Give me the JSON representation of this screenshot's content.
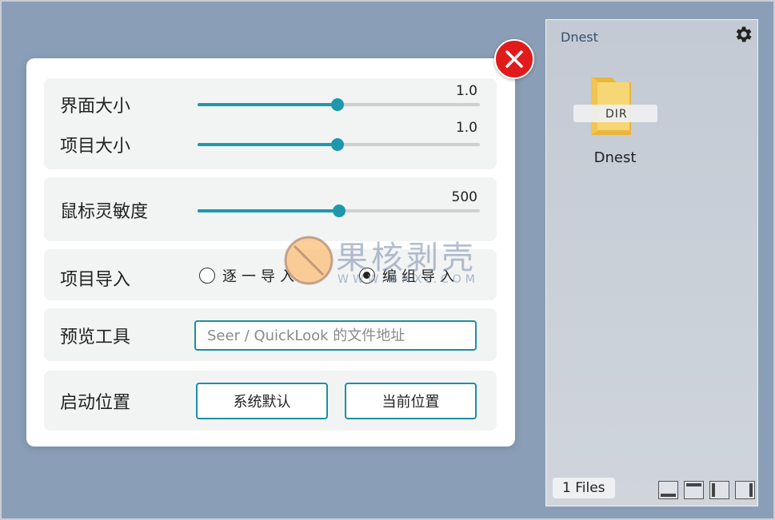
{
  "settings": {
    "ui_size": {
      "label": "界面大小",
      "value": "1.0",
      "fraction": 0.495
    },
    "item_size": {
      "label": "项目大小",
      "value": "1.0",
      "fraction": 0.495
    },
    "mouse_sensitivity": {
      "label": "鼠标灵敏度",
      "value": "500",
      "fraction": 0.5
    },
    "item_import": {
      "label": "项目导入",
      "options": [
        "逐一导入",
        "编组导入"
      ],
      "selected": "编组导入"
    },
    "preview_tool": {
      "label": "预览工具",
      "placeholder": "Seer / QuickLook 的文件地址"
    },
    "start_position": {
      "label": "启动位置",
      "buttons": [
        "系统默认",
        "当前位置"
      ]
    },
    "close_icon": "close-x-icon"
  },
  "watermark": {
    "title": "果核剥壳",
    "subtitle": "WWW.GHXI.COM"
  },
  "panel": {
    "title": "Dnest",
    "gear_icon": "gear-icon",
    "folder": {
      "badge": "DIR",
      "name": "Dnest"
    },
    "files_count": "1 Files",
    "layout_buttons": [
      "dock-bottom-icon",
      "dock-top-icon",
      "dock-left-icon",
      "dock-right-icon"
    ]
  },
  "colors": {
    "desktop": "#8a9fb7",
    "accent": "#1d98ad",
    "close": "#e11b1b",
    "folder": "#f3c44e"
  }
}
